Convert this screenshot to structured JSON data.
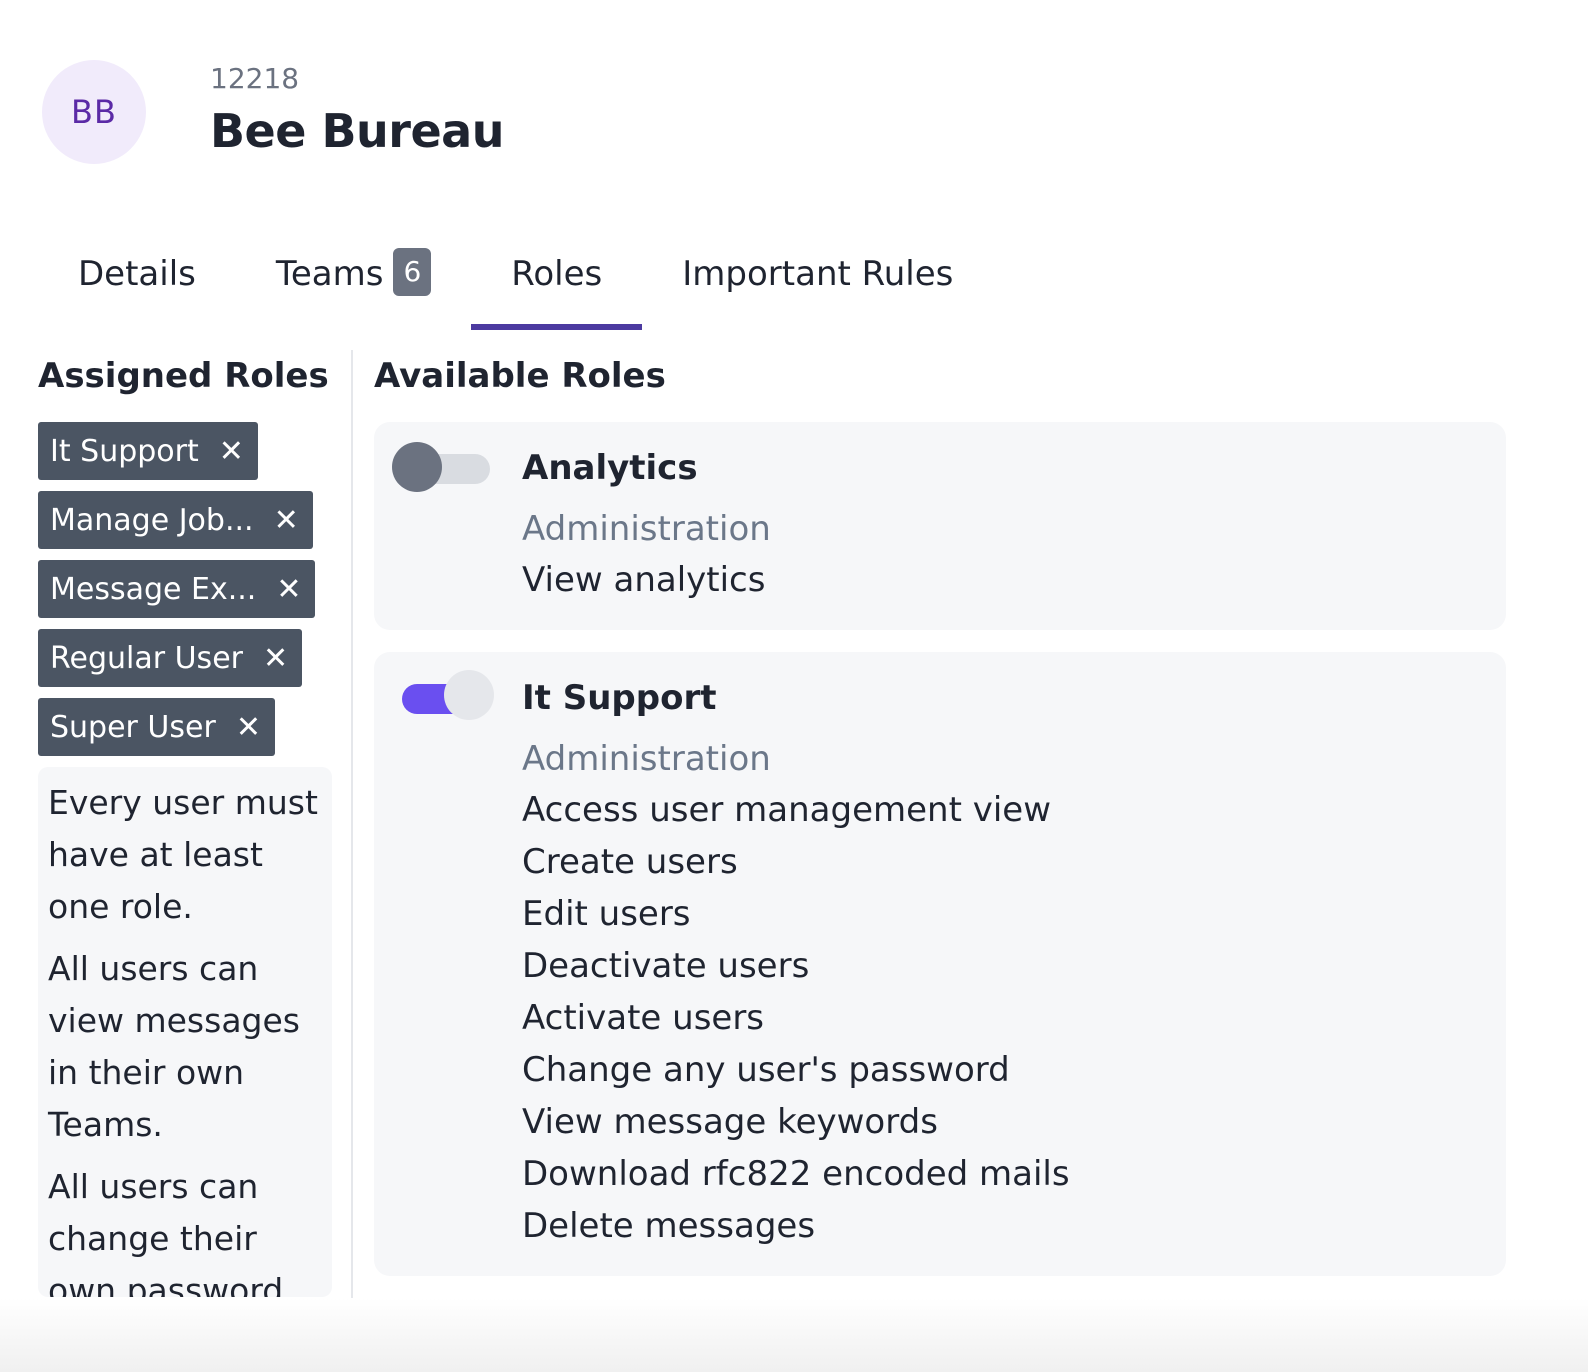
{
  "header": {
    "avatar_initials": "BB",
    "org_id": "12218",
    "org_name": "Bee Bureau"
  },
  "tabs": [
    {
      "label": "Details",
      "active": false
    },
    {
      "label": "Teams",
      "badge": "6",
      "active": false
    },
    {
      "label": "Roles",
      "active": true
    },
    {
      "label": "Important Rules",
      "active": false
    }
  ],
  "assigned": {
    "title": "Assigned Roles",
    "chips": [
      "It Support",
      "Manage Job...",
      "Message Ex...",
      "Regular User",
      "Super User"
    ],
    "close_glyph": "✕",
    "rules": [
      "Every user must have at least one role.",
      "All users can view messages in their own Teams.",
      "All users can change their own password."
    ]
  },
  "available": {
    "title": "Available Roles",
    "roles": [
      {
        "name": "Analytics",
        "enabled": false,
        "category": "Administration",
        "permissions": [
          "View analytics"
        ]
      },
      {
        "name": "It Support",
        "enabled": true,
        "category": "Administration",
        "permissions": [
          "Access user management view",
          "Create users",
          "Edit users",
          "Deactivate users",
          "Activate users",
          "Change any user's password",
          "View message keywords",
          "Download rfc822 encoded mails",
          "Delete messages"
        ]
      }
    ]
  },
  "colors": {
    "accent": "#4c3aa0",
    "toggle_on": "#6a4ff0",
    "chip_bg": "#4b5563",
    "avatar_bg": "#f1ebfb",
    "avatar_text": "#5b2aa6"
  }
}
